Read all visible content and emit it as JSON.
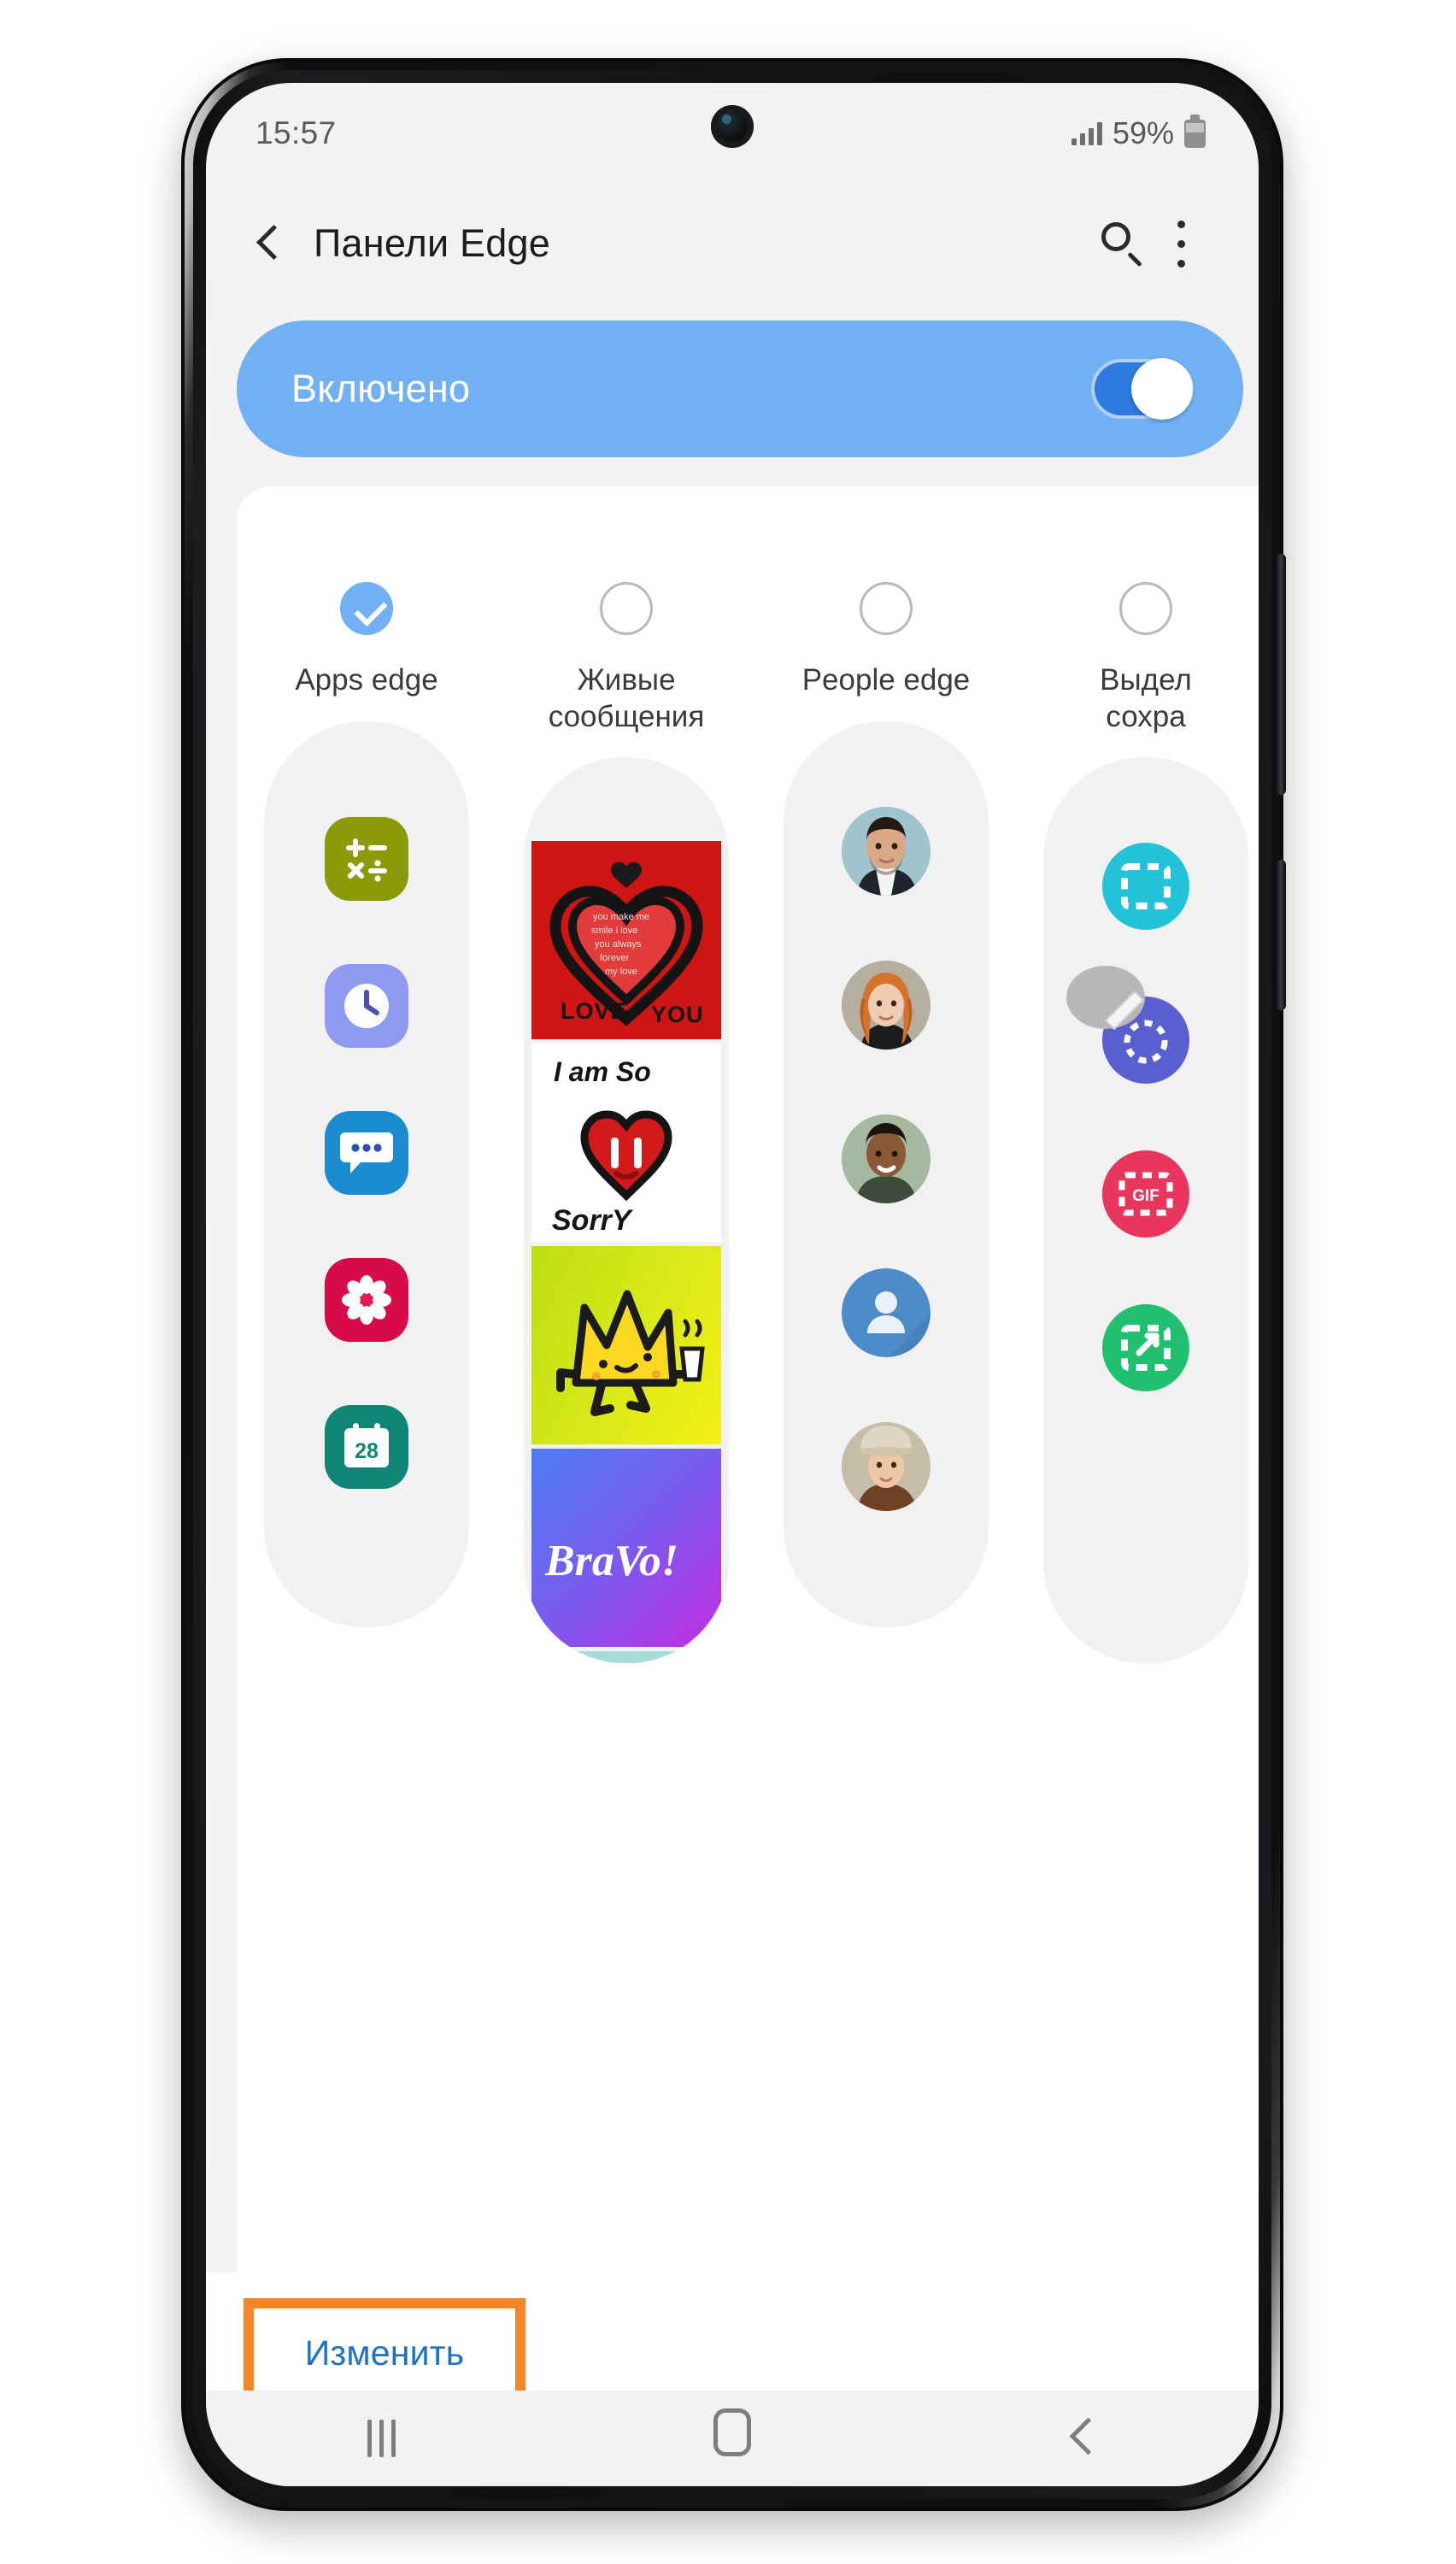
{
  "status_bar": {
    "time": "15:57",
    "battery_percent": "59%",
    "signal_icon": "signal-bars-icon",
    "battery_icon": "battery-icon"
  },
  "app_bar": {
    "back_icon": "back-chevron-icon",
    "title": "Панели Edge",
    "search_icon": "search-icon",
    "overflow_icon": "more-options-icon"
  },
  "enable_bar": {
    "label": "Включено",
    "toggle_state": "on",
    "bar_color": "#72b0f4",
    "track_color": "#2e7ae0"
  },
  "panels": [
    {
      "id": "apps-edge",
      "label": "Apps edge",
      "selected": true,
      "preview_type": "app-icons",
      "items": [
        {
          "name": "calculator-icon",
          "color": "#8a9a08"
        },
        {
          "name": "clock-icon",
          "color": "#8e9af0"
        },
        {
          "name": "messages-icon",
          "color": "#1b8cd0"
        },
        {
          "name": "gallery-icon",
          "color": "#d70a4a"
        },
        {
          "name": "calendar-icon",
          "color": "#0f8676",
          "day": "28"
        }
      ]
    },
    {
      "id": "live-messages",
      "label": "Живые\nсообщения",
      "selected": false,
      "preview_type": "message-thumbs",
      "items": [
        {
          "name": "love-you-thumb",
          "caption": "LOVE YOU",
          "bg": "#cf1414"
        },
        {
          "name": "sorry-thumb",
          "caption": "I am So Sorry",
          "bg": "#ffffff"
        },
        {
          "name": "crown-thumb",
          "caption": "",
          "bg": "#c8e018"
        },
        {
          "name": "bravo-thumb",
          "caption": "BraVo!",
          "bg": "#5b6ef0"
        },
        {
          "name": "cat-thumb",
          "caption": "",
          "bg": "#a8dcd8"
        }
      ]
    },
    {
      "id": "people-edge",
      "label": "People edge",
      "selected": false,
      "preview_type": "avatars",
      "items": [
        {
          "name": "contact-avatar-1",
          "kind": "photo-man-suit"
        },
        {
          "name": "contact-avatar-2",
          "kind": "photo-woman-red-hair"
        },
        {
          "name": "contact-avatar-3",
          "kind": "photo-man-green-bg"
        },
        {
          "name": "contact-avatar-4",
          "kind": "default-person-icon"
        },
        {
          "name": "contact-avatar-5",
          "kind": "photo-woman-hat"
        }
      ]
    },
    {
      "id": "smart-select",
      "label": "Выдел\nсохра",
      "selected": false,
      "preview_type": "tool-icons",
      "items": [
        {
          "name": "rectangle-select-icon",
          "color": "#22c3d8"
        },
        {
          "name": "lasso-select-icon",
          "color": "#5a5fd0"
        },
        {
          "name": "gif-capture-icon",
          "color": "#e8365f",
          "text": "GIF"
        },
        {
          "name": "pin-to-screen-icon",
          "color": "#20c070"
        }
      ]
    }
  ],
  "edit_button": {
    "label": "Изменить",
    "text_color": "#1a73c7",
    "highlight_color": "#f5862a"
  },
  "nav_bar": {
    "recents_icon": "recents-icon",
    "home_icon": "home-icon",
    "back_icon": "nav-back-icon"
  }
}
